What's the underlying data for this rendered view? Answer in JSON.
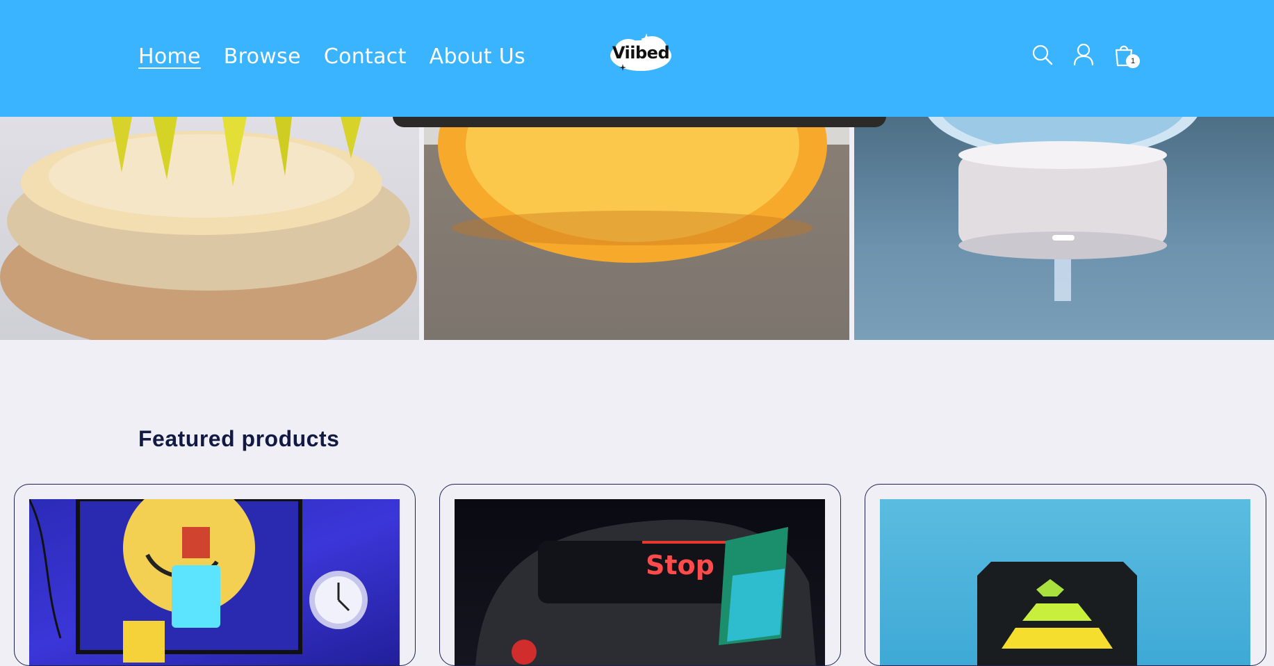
{
  "nav": {
    "items": [
      "Home",
      "Browse",
      "Contact",
      "About Us"
    ],
    "active": "Home"
  },
  "logo": {
    "text": "Viibed"
  },
  "header_icons": {
    "search": "search-icon",
    "account": "account-icon",
    "cart": "cart-icon",
    "cart_count": "1"
  },
  "featured": {
    "title": "Featured products"
  },
  "colors": {
    "header_bg": "#3ab4ff",
    "page_bg": "#efeff5",
    "heading": "#121a44"
  },
  "display_text": {
    "car_sign": "Stop"
  }
}
